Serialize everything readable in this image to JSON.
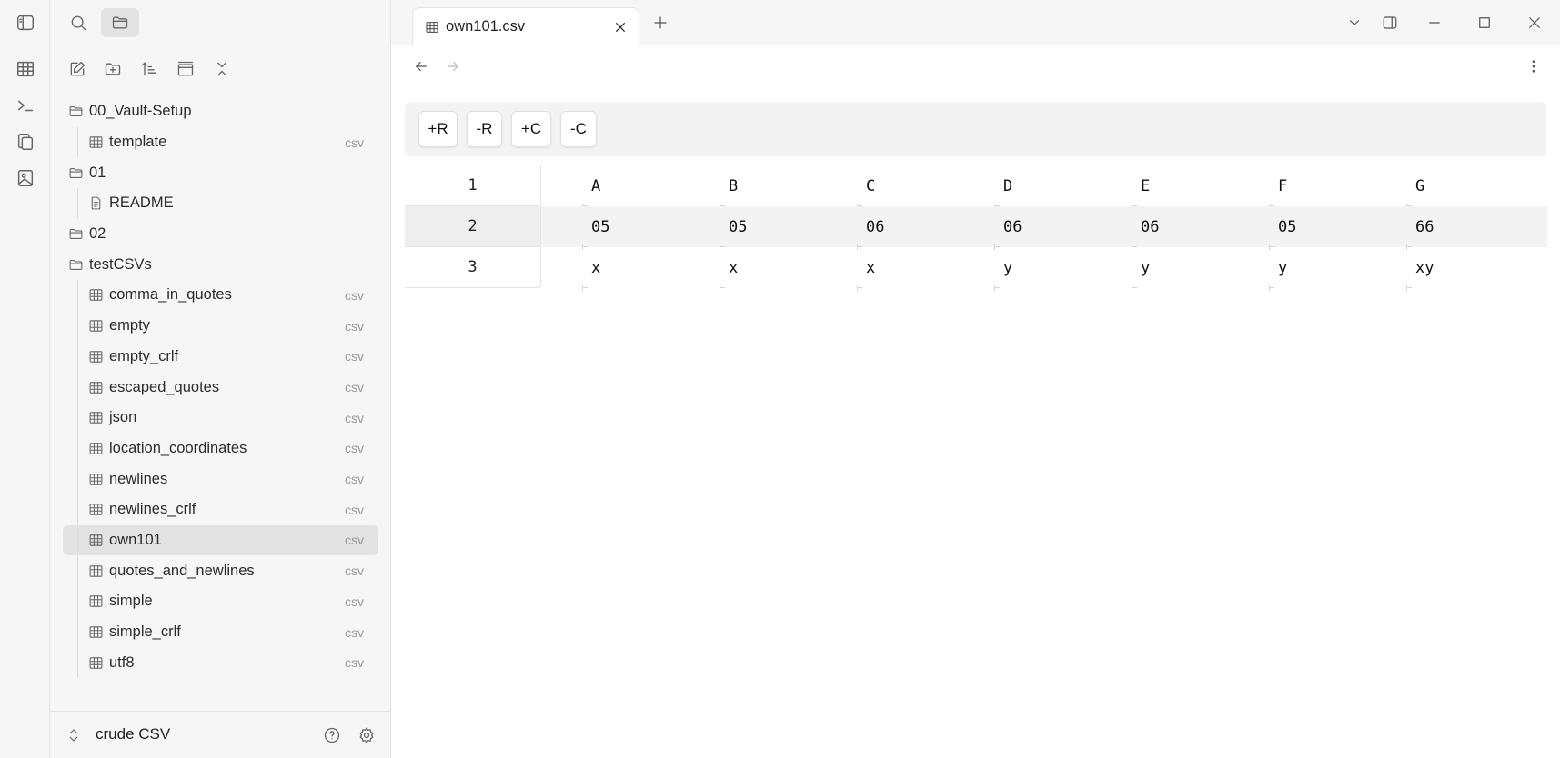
{
  "ribbon": {
    "items": [
      "sidebar-toggle-icon",
      "table-icon",
      "terminal-icon",
      "copy-icon",
      "image-icon"
    ]
  },
  "sidebar": {
    "top_icons": [
      "search-icon",
      "folder-icon"
    ],
    "toolbar": [
      "new-note-icon",
      "new-folder-icon",
      "sort-icon",
      "collapse-panel-icon",
      "collapse-all-icon"
    ],
    "tree": [
      {
        "type": "folder",
        "name": "00_Vault-Setup"
      },
      {
        "type": "file",
        "name": "template",
        "ext": "csv",
        "icon": "table-icon"
      },
      {
        "type": "folder",
        "name": "01"
      },
      {
        "type": "file",
        "name": "README",
        "ext": "",
        "icon": "document-icon"
      },
      {
        "type": "folder",
        "name": "02"
      },
      {
        "type": "folder",
        "name": "testCSVs"
      },
      {
        "type": "file",
        "name": "comma_in_quotes",
        "ext": "csv",
        "icon": "table-icon"
      },
      {
        "type": "file",
        "name": "empty",
        "ext": "csv",
        "icon": "table-icon"
      },
      {
        "type": "file",
        "name": "empty_crlf",
        "ext": "csv",
        "icon": "table-icon"
      },
      {
        "type": "file",
        "name": "escaped_quotes",
        "ext": "csv",
        "icon": "table-icon"
      },
      {
        "type": "file",
        "name": "json",
        "ext": "csv",
        "icon": "table-icon"
      },
      {
        "type": "file",
        "name": "location_coordinates",
        "ext": "csv",
        "icon": "table-icon"
      },
      {
        "type": "file",
        "name": "newlines",
        "ext": "csv",
        "icon": "table-icon"
      },
      {
        "type": "file",
        "name": "newlines_crlf",
        "ext": "csv",
        "icon": "table-icon"
      },
      {
        "type": "file",
        "name": "own101",
        "ext": "csv",
        "icon": "table-icon",
        "selected": true
      },
      {
        "type": "file",
        "name": "quotes_and_newlines",
        "ext": "csv",
        "icon": "table-icon"
      },
      {
        "type": "file",
        "name": "simple",
        "ext": "csv",
        "icon": "table-icon"
      },
      {
        "type": "file",
        "name": "simple_crlf",
        "ext": "csv",
        "icon": "table-icon"
      },
      {
        "type": "file",
        "name": "utf8",
        "ext": "csv",
        "icon": "table-icon"
      }
    ],
    "footer": {
      "vault_name": "crude CSV"
    }
  },
  "tab": {
    "title": "own101.csv"
  },
  "csv": {
    "buttons": [
      "+R",
      "-R",
      "+C",
      "-C"
    ],
    "row_numbers": [
      "1",
      "2",
      "3"
    ],
    "rows": [
      [
        "A",
        "B",
        "C",
        "D",
        "E",
        "F",
        "G"
      ],
      [
        "05",
        "05",
        "06",
        "06",
        "06",
        "05",
        "66"
      ],
      [
        "x",
        "x",
        "x",
        "y",
        "y",
        "y",
        "xy"
      ]
    ]
  },
  "colors": {
    "sidebar_bg": "#f6f6f6",
    "selected_bg": "#e3e3e3",
    "alt_row_bg": "#f3f3f3"
  }
}
